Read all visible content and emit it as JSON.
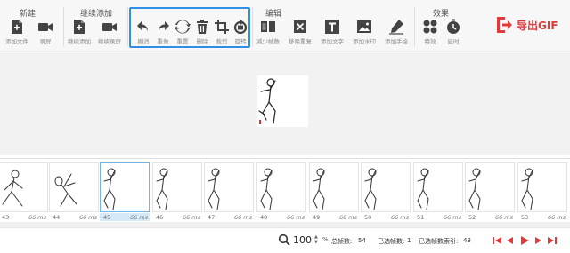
{
  "toolbar": {
    "groups": {
      "new": "新建",
      "continue": "继续添加",
      "edit": "编辑",
      "effects": "效果"
    },
    "buttons": {
      "add_file": "添加文件",
      "record": "录屏",
      "continue_add": "继续添加",
      "continue_record": "继续录屏",
      "undo": "撤消",
      "redo": "重做",
      "reset": "重置",
      "delete": "删除",
      "crop": "裁剪",
      "rotate": "旋转",
      "reduce_frames": "减少帧数",
      "remove_duplicates": "移除重复",
      "add_text": "添加文字",
      "add_watermark": "添加水印",
      "add_handwriting": "添加手绘",
      "effects": "特效",
      "delay": "延时"
    },
    "export_label": "导出GIF"
  },
  "frames": [
    {
      "num": "43",
      "ms": "66 ms"
    },
    {
      "num": "44",
      "ms": "66 ms"
    },
    {
      "num": "45",
      "ms": "66 ms",
      "selected": true
    },
    {
      "num": "46",
      "ms": "66 ms"
    },
    {
      "num": "47",
      "ms": "66 ms"
    },
    {
      "num": "48",
      "ms": "66 ms"
    },
    {
      "num": "49",
      "ms": "66 ms"
    },
    {
      "num": "50",
      "ms": "66 ms"
    },
    {
      "num": "51",
      "ms": "66 ms"
    },
    {
      "num": "52",
      "ms": "66 ms"
    },
    {
      "num": "53",
      "ms": "66 ms"
    }
  ],
  "status": {
    "zoom_value": "100",
    "zoom_unit": "%",
    "total_frames_label": "总帧数:",
    "total_frames": "54",
    "selected_frames_label": "已选帧数:",
    "selected_frames": "1",
    "selected_index_label": "已选帧数索引:",
    "selected_index": "43"
  },
  "colors": {
    "accent_blue": "#2f8fe6",
    "export_red": "#e03a3a",
    "nav_red": "#e03a3a",
    "selected_frame_bg": "#d6e9f8"
  }
}
